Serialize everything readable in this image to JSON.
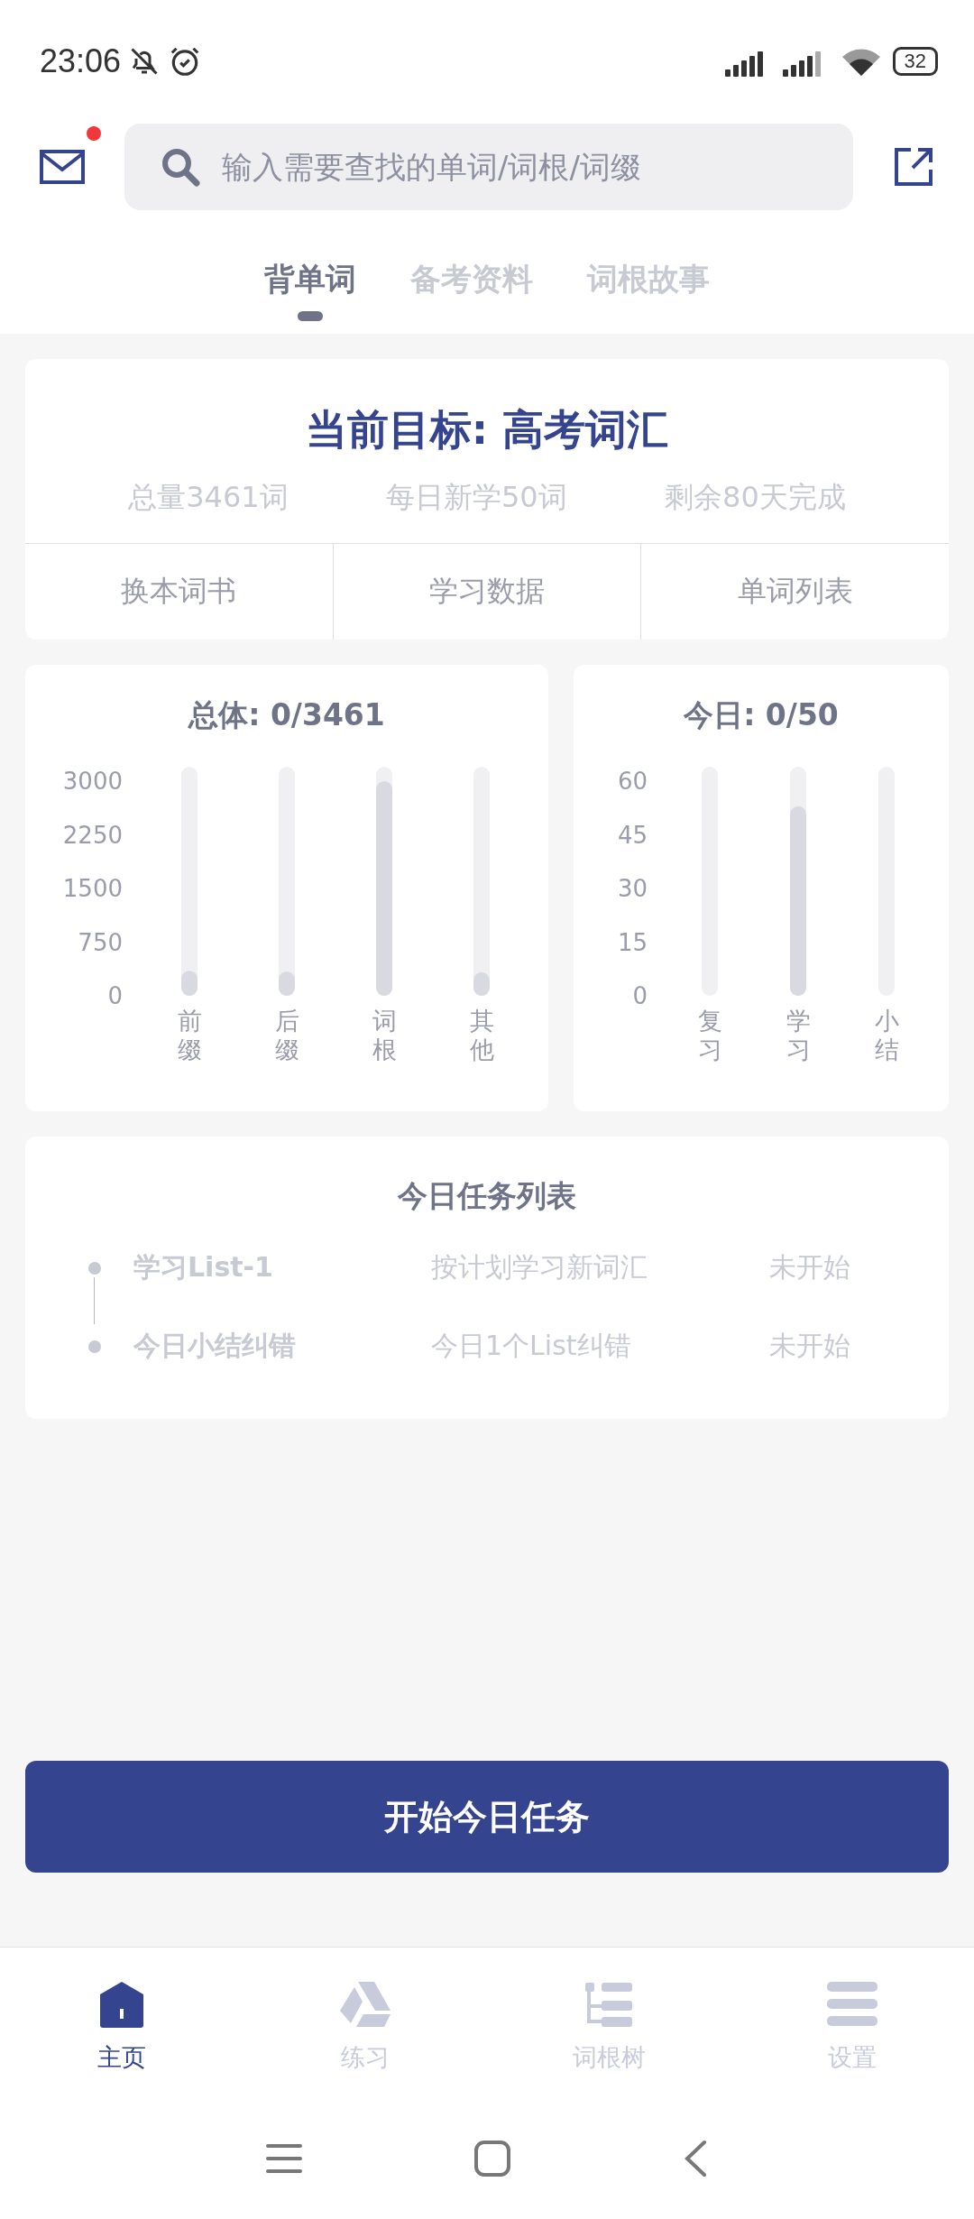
{
  "status_bar": {
    "time": "23:06",
    "battery": "32"
  },
  "header": {
    "mail_unread": true,
    "search": {
      "placeholder": "输入需要查找的单词/词根/词缀"
    }
  },
  "tabs": [
    {
      "label": "背单词",
      "selected": true
    },
    {
      "label": "备考资料",
      "selected": false
    },
    {
      "label": "词根故事",
      "selected": false
    }
  ],
  "goal_card": {
    "title": "当前目标: 高考词汇",
    "stats": [
      "总量3461词",
      "每日新学50词",
      "剩余80天完成"
    ],
    "actions": [
      "换本词书",
      "学习数据",
      "单词列表"
    ]
  },
  "overall_chart": {
    "chart_data": {
      "type": "bar",
      "title": "总体: 0/3461",
      "categories": [
        "前缀",
        "后缀",
        "词根",
        "其他"
      ],
      "series": [
        {
          "color": "#d9dae1",
          "values": [
            350,
            340,
            3000,
            330
          ]
        }
      ],
      "ylim": [
        0,
        3000
      ],
      "grid": true,
      "yticks": [
        0,
        750,
        1500,
        2250,
        3000
      ]
    }
  },
  "today_chart": {
    "chart_data": {
      "type": "bar",
      "title": "今日: 0/50",
      "categories": [
        "复习",
        "学习",
        "小结"
      ],
      "series": [
        {
          "color": "#d9dae1",
          "values": [
            0,
            53,
            0
          ]
        }
      ],
      "ylim": [
        0,
        60
      ],
      "grid": true,
      "yticks": [
        0,
        15,
        30,
        45,
        60
      ]
    }
  },
  "task_list": {
    "title": "今日任务列表",
    "tasks": [
      {
        "name": "学习List-1",
        "description": "按计划学习新词汇",
        "status": "未开始"
      },
      {
        "name": "今日小结纠错",
        "description": "今日1个List纠错",
        "status": "未开始"
      }
    ]
  },
  "start_button": "开始今日任务",
  "bottom_nav": [
    {
      "label": "主页",
      "kind": "home",
      "selected": true
    },
    {
      "label": "练习",
      "kind": "practice",
      "selected": false
    },
    {
      "label": "词根树",
      "kind": "tree",
      "selected": false
    },
    {
      "label": "设置",
      "kind": "settings",
      "selected": false
    }
  ]
}
